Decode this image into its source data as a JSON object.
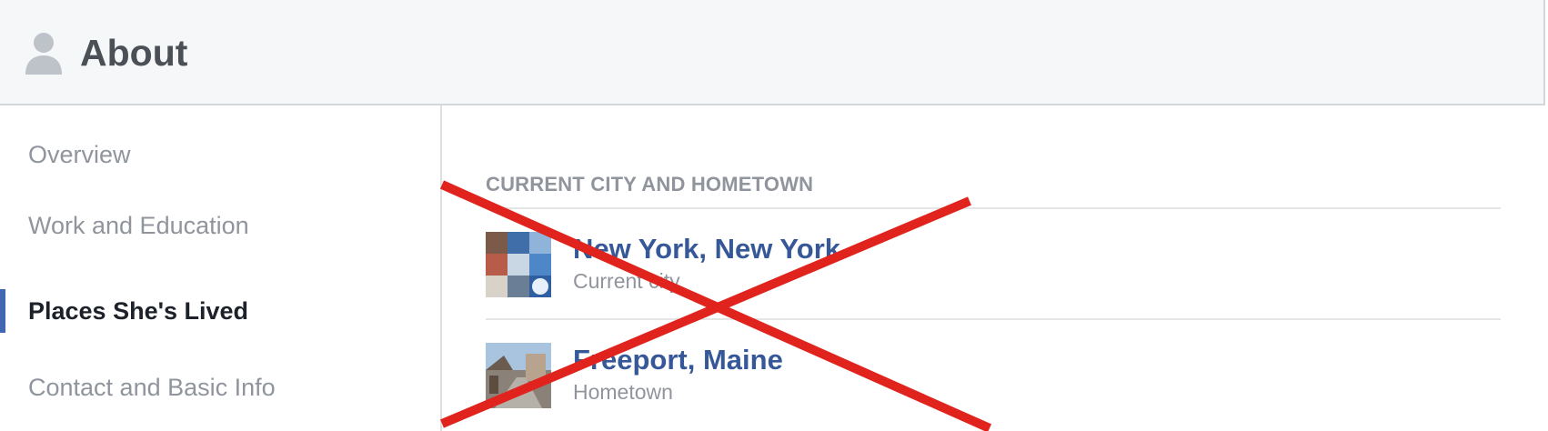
{
  "header": {
    "title": "About",
    "icon": "person-silhouette-icon"
  },
  "sidebar": {
    "items": [
      {
        "label": "Overview",
        "active": false
      },
      {
        "label": "Work and Education",
        "active": false
      },
      {
        "label": "Places She's Lived",
        "active": true
      },
      {
        "label": "Contact and Basic Info",
        "active": false
      }
    ],
    "accent_color": "#4267b2"
  },
  "main": {
    "section_title": "CURRENT CITY AND HOMETOWN",
    "places": [
      {
        "name": "New York, New York",
        "subtitle": "Current city",
        "thumbnail": "city-collage-thumbnail"
      },
      {
        "name": "Freeport, Maine",
        "subtitle": "Hometown",
        "thumbnail": "street-photo-thumbnail"
      }
    ],
    "link_color": "#365899"
  },
  "overlay": {
    "mark": "red-x-cross-out",
    "color": "#e0231c"
  }
}
